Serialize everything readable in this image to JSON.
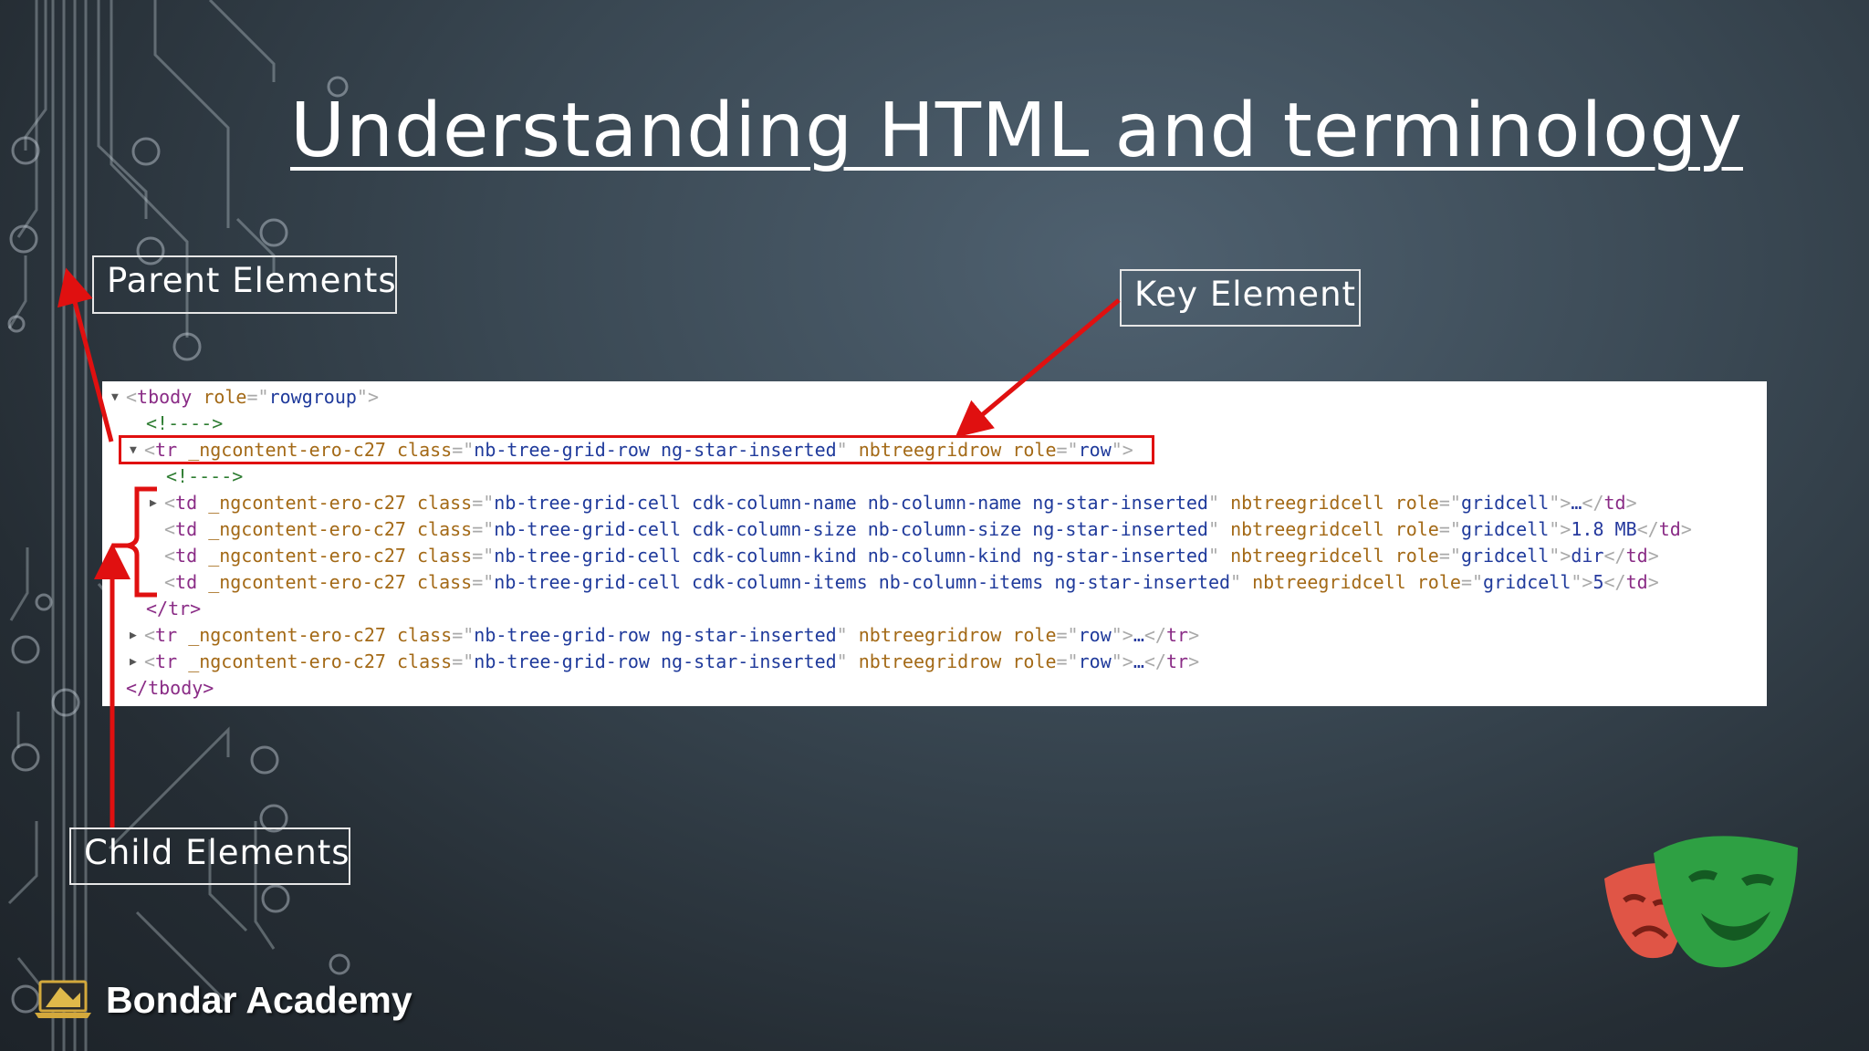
{
  "slide": {
    "title": "Understanding HTML and terminology"
  },
  "callouts": {
    "parent": "Parent Elements",
    "key": "Key Element",
    "child": "Child Elements"
  },
  "code": {
    "tbody_open": {
      "tag": "tbody",
      "attr": "role",
      "val": "rowgroup"
    },
    "comment": "<!---->",
    "tr_key": {
      "tag": "tr",
      "attr1": "_ngcontent-ero-c27",
      "attr2": "class",
      "val2": "nb-tree-grid-row ng-star-inserted",
      "attr3": "nbtreegridrow",
      "attr4": "role",
      "val4": "row"
    },
    "td_rows": [
      {
        "attr1": "_ngcontent-ero-c27",
        "attr2": "class",
        "cls": "nb-tree-grid-cell cdk-column-name nb-column-name ng-star-inserted",
        "attr3": "nbtreegridcell",
        "attr4": "role",
        "val4": "gridcell",
        "content": "…"
      },
      {
        "attr1": "_ngcontent-ero-c27",
        "attr2": "class",
        "cls": "nb-tree-grid-cell cdk-column-size nb-column-size ng-star-inserted",
        "attr3": "nbtreegridcell",
        "attr4": "role",
        "val4": "gridcell",
        "content": "1.8 MB"
      },
      {
        "attr1": "_ngcontent-ero-c27",
        "attr2": "class",
        "cls": "nb-tree-grid-cell cdk-column-kind nb-column-kind ng-star-inserted",
        "attr3": "nbtreegridcell",
        "attr4": "role",
        "val4": "gridcell",
        "content": "dir"
      },
      {
        "attr1": "_ngcontent-ero-c27",
        "attr2": "class",
        "cls": "nb-tree-grid-cell cdk-column-items nb-column-items ng-star-inserted",
        "attr3": "nbtreegridcell",
        "attr4": "role",
        "val4": "gridcell",
        "content": "5"
      }
    ],
    "tr_close": "</tr>",
    "tr_collapsed": [
      {
        "attr1": "_ngcontent-ero-c27",
        "attr2": "class",
        "val2": "nb-tree-grid-row ng-star-inserted",
        "attr3": "nbtreegridrow",
        "attr4": "role",
        "val4": "row",
        "content": "…"
      },
      {
        "attr1": "_ngcontent-ero-c27",
        "attr2": "class",
        "val2": "nb-tree-grid-row ng-star-inserted",
        "attr3": "nbtreegridrow",
        "attr4": "role",
        "val4": "row",
        "content": "…"
      }
    ],
    "tbody_close": "</tbody>"
  },
  "brand": {
    "name": "Bondar Academy"
  },
  "colors": {
    "annotation_red": "#e01010",
    "mask_red": "#e05546",
    "mask_green": "#2ea043"
  }
}
